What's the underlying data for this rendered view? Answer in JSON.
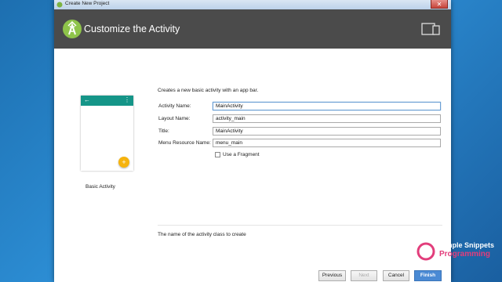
{
  "window": {
    "title": "Create New Project",
    "close_glyph": "✕"
  },
  "header": {
    "title": "Customize the Activity",
    "logo_icon": "android-studio-icon",
    "device_icon": "phone-tablet-icon"
  },
  "template": {
    "name": "Basic Activity",
    "back_glyph": "←",
    "menu_glyph": "⋮",
    "fab_glyph": "+"
  },
  "form": {
    "description": "Creates a new basic activity with an app bar.",
    "fields": [
      {
        "label": "Activity Name:",
        "value": "MainActivity"
      },
      {
        "label": "Layout Name:",
        "value": "activity_main"
      },
      {
        "label": "Title:",
        "value": "MainActivity"
      },
      {
        "label": "Menu Resource Name:",
        "value": "menu_main"
      }
    ],
    "use_fragment": {
      "label": "Use a Fragment",
      "checked": false
    }
  },
  "hint": "The name of the activity class to create",
  "buttons": {
    "previous": "Previous",
    "next": "Next",
    "cancel": "Cancel",
    "finish": "Finish"
  },
  "watermark": {
    "line1": "Simple Snippets",
    "line2": "Programming"
  },
  "colors": {
    "header_bg": "#4b4b4b",
    "app_bar": "#159588",
    "fab": "#f6b30d",
    "primary_button": "#4a8ad4",
    "desktop": "#2d8fd6"
  }
}
